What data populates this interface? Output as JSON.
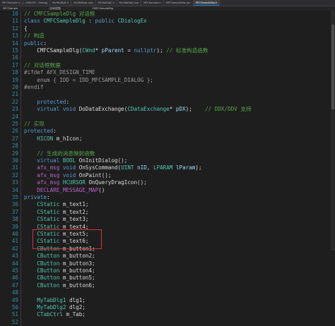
{
  "tabs": [
    {
      "label": "MFCSample.rc - [...DIALOG - Dialog]",
      "active": false
    },
    {
      "label": "MyTabDlg1.h",
      "active": false
    },
    {
      "label": "MyTabDlg1.cpp",
      "active": false
    },
    {
      "label": "MyTabDlg2.h",
      "active": false
    },
    {
      "label": "MyTabDlg2.cpp",
      "active": false
    },
    {
      "label": "MFCSample.h",
      "active": false
    },
    {
      "label": "MFCSampleDlg.cpp",
      "active": false
    },
    {
      "label": "MFCSampleDlg.h",
      "active": true
    }
  ],
  "navbar": {
    "project": "MFCSample",
    "scope": "(全局范围)",
    "member": "CMFCSampleDlg"
  },
  "lines": [
    {
      "n": "10",
      "fold": true,
      "tokens": [
        {
          "t": "// CMFCSampleDlg 对话框",
          "c": "cm"
        }
      ]
    },
    {
      "n": "11",
      "fold": true,
      "tokens": [
        {
          "t": "class ",
          "c": "kw"
        },
        {
          "t": "CMFCSampleDlg",
          "c": "ty"
        },
        {
          "t": " : "
        },
        {
          "t": "public ",
          "c": "kw"
        },
        {
          "t": "CDialogEx",
          "c": "ty"
        }
      ]
    },
    {
      "n": "12",
      "tokens": [
        {
          "t": "{"
        }
      ]
    },
    {
      "n": "13",
      "tokens": [
        {
          "t": "// 构造",
          "c": "cm"
        }
      ]
    },
    {
      "n": "14",
      "tokens": [
        {
          "t": "public",
          "c": "kw"
        },
        {
          "t": ":"
        }
      ]
    },
    {
      "n": "15",
      "tokens": [
        {
          "t": "    CMFCSampleDlg("
        },
        {
          "t": "CWnd",
          "c": "ty"
        },
        {
          "t": "* "
        },
        {
          "t": "pParent",
          "c": "pa"
        },
        {
          "t": " = "
        },
        {
          "t": "nullptr",
          "c": "kw"
        },
        {
          "t": "); "
        },
        {
          "t": "// 标准构造函数",
          "c": "cm"
        }
      ]
    },
    {
      "n": "16",
      "tokens": []
    },
    {
      "n": "17",
      "tokens": [
        {
          "t": "// 对话框数据",
          "c": "cm"
        }
      ]
    },
    {
      "n": "18",
      "fold": true,
      "tokens": [
        {
          "t": "#ifdef AFX_DESIGN_TIME",
          "c": "pp"
        }
      ]
    },
    {
      "n": "19",
      "tokens": [
        {
          "t": "    enum { IDD = IDD_MFCSAMPLE_DIALOG };",
          "c": "pp"
        }
      ]
    },
    {
      "n": "20",
      "tokens": [
        {
          "t": "#endif",
          "c": "pp"
        }
      ]
    },
    {
      "n": "21",
      "tokens": []
    },
    {
      "n": "22",
      "tokens": [
        {
          "t": "    protected",
          "c": "kw"
        },
        {
          "t": ":"
        }
      ]
    },
    {
      "n": "23",
      "tokens": [
        {
          "t": "    virtual ",
          "c": "kw"
        },
        {
          "t": "void ",
          "c": "kw"
        },
        {
          "t": "DoDataExchange("
        },
        {
          "t": "CDataExchange",
          "c": "ty"
        },
        {
          "t": "* "
        },
        {
          "t": "pDX",
          "c": "pa"
        },
        {
          "t": ");    "
        },
        {
          "t": "// DDX/DDV 支持",
          "c": "cm"
        }
      ]
    },
    {
      "n": "24",
      "tokens": []
    },
    {
      "n": "25",
      "tokens": [
        {
          "t": "// 实现",
          "c": "cm"
        }
      ]
    },
    {
      "n": "26",
      "tokens": [
        {
          "t": "protected",
          "c": "kw"
        },
        {
          "t": ":"
        }
      ]
    },
    {
      "n": "27",
      "tokens": [
        {
          "t": "    "
        },
        {
          "t": "HICON",
          "c": "ty"
        },
        {
          "t": " m_hIcon;"
        }
      ]
    },
    {
      "n": "28",
      "tokens": []
    },
    {
      "n": "29",
      "tokens": [
        {
          "t": "    // 生成的消息映射函数",
          "c": "cm"
        }
      ]
    },
    {
      "n": "30",
      "tokens": [
        {
          "t": "    virtual ",
          "c": "kw"
        },
        {
          "t": "BOOL",
          "c": "ty"
        },
        {
          "t": " OnInitDialog();"
        }
      ]
    },
    {
      "n": "31",
      "tokens": [
        {
          "t": "    "
        },
        {
          "t": "afx_msg",
          "c": "mc"
        },
        {
          "t": " "
        },
        {
          "t": "void ",
          "c": "kw"
        },
        {
          "t": "OnSysCommand("
        },
        {
          "t": "UINT",
          "c": "ty"
        },
        {
          "t": " "
        },
        {
          "t": "nID",
          "c": "pa"
        },
        {
          "t": ", "
        },
        {
          "t": "LPARAM",
          "c": "ty"
        },
        {
          "t": " "
        },
        {
          "t": "lParam",
          "c": "pa"
        },
        {
          "t": ");"
        }
      ]
    },
    {
      "n": "32",
      "tokens": [
        {
          "t": "    "
        },
        {
          "t": "afx_msg",
          "c": "mc"
        },
        {
          "t": " "
        },
        {
          "t": "void ",
          "c": "kw"
        },
        {
          "t": "OnPaint();"
        }
      ]
    },
    {
      "n": "33",
      "tokens": [
        {
          "t": "    "
        },
        {
          "t": "afx_msg",
          "c": "mc"
        },
        {
          "t": " "
        },
        {
          "t": "HCURSOR",
          "c": "ty"
        },
        {
          "t": " OnQueryDragIcon();"
        }
      ]
    },
    {
      "n": "34",
      "tokens": [
        {
          "t": "    "
        },
        {
          "t": "DECLARE_MESSAGE_MAP",
          "c": "mc"
        },
        {
          "t": "()"
        }
      ]
    },
    {
      "n": "35",
      "tokens": [
        {
          "t": "private",
          "c": "kw"
        },
        {
          "t": ":"
        }
      ]
    },
    {
      "n": "36",
      "tokens": [
        {
          "t": "    "
        },
        {
          "t": "CStatic",
          "c": "ty"
        },
        {
          "t": " m_text1;"
        }
      ]
    },
    {
      "n": "37",
      "tokens": [
        {
          "t": "    "
        },
        {
          "t": "CStatic",
          "c": "ty"
        },
        {
          "t": " m_text2;"
        }
      ]
    },
    {
      "n": "38",
      "tokens": [
        {
          "t": "    "
        },
        {
          "t": "CStatic",
          "c": "ty"
        },
        {
          "t": " m_text3;"
        }
      ]
    },
    {
      "n": "39",
      "tokens": [
        {
          "t": "    "
        },
        {
          "t": "CStatic",
          "c": "ty"
        },
        {
          "t": " m_text4;"
        }
      ]
    },
    {
      "n": "40",
      "tokens": [
        {
          "t": "    "
        },
        {
          "t": "CStatic",
          "c": "ty"
        },
        {
          "t": " m_text5;"
        }
      ]
    },
    {
      "n": "41",
      "tokens": [
        {
          "t": "    "
        },
        {
          "t": "CStatic",
          "c": "ty"
        },
        {
          "t": " m_text6;"
        }
      ]
    },
    {
      "n": "42",
      "tokens": [
        {
          "t": "    "
        },
        {
          "t": "CButton",
          "c": "ty"
        },
        {
          "t": " m_button1;"
        }
      ]
    },
    {
      "n": "43",
      "tokens": [
        {
          "t": "    "
        },
        {
          "t": "CButton",
          "c": "ty"
        },
        {
          "t": " m_button2;"
        }
      ]
    },
    {
      "n": "44",
      "tokens": [
        {
          "t": "    "
        },
        {
          "t": "CButton",
          "c": "ty"
        },
        {
          "t": " m_button3;"
        }
      ]
    },
    {
      "n": "45",
      "tokens": [
        {
          "t": "    "
        },
        {
          "t": "CButton",
          "c": "ty"
        },
        {
          "t": " m_button4;"
        }
      ]
    },
    {
      "n": "46",
      "tokens": [
        {
          "t": "    "
        },
        {
          "t": "CButton",
          "c": "ty"
        },
        {
          "t": " m_button5;"
        }
      ]
    },
    {
      "n": "47",
      "tokens": [
        {
          "t": "    "
        },
        {
          "t": "CButton",
          "c": "ty"
        },
        {
          "t": " m_button6;"
        }
      ]
    },
    {
      "n": "48",
      "tokens": []
    },
    {
      "n": "49",
      "tokens": [
        {
          "t": "    "
        },
        {
          "t": "MyTabDlg1",
          "c": "ty"
        },
        {
          "t": " dlg1;"
        }
      ]
    },
    {
      "n": "50",
      "tokens": [
        {
          "t": "    "
        },
        {
          "t": "MyTabDlg2",
          "c": "ty"
        },
        {
          "t": " dlg2;"
        }
      ]
    },
    {
      "n": "51",
      "tokens": [
        {
          "t": "    "
        },
        {
          "t": "CTabCtrl",
          "c": "ty"
        },
        {
          "t": " m_Tab;"
        }
      ]
    },
    {
      "n": "52",
      "tokens": []
    }
  ],
  "colors": {
    "background": "#1e1e1e",
    "keyword": "#569cd6",
    "type": "#4ec9b0",
    "comment": "#57a64a",
    "highlight_box": "#d13438"
  }
}
